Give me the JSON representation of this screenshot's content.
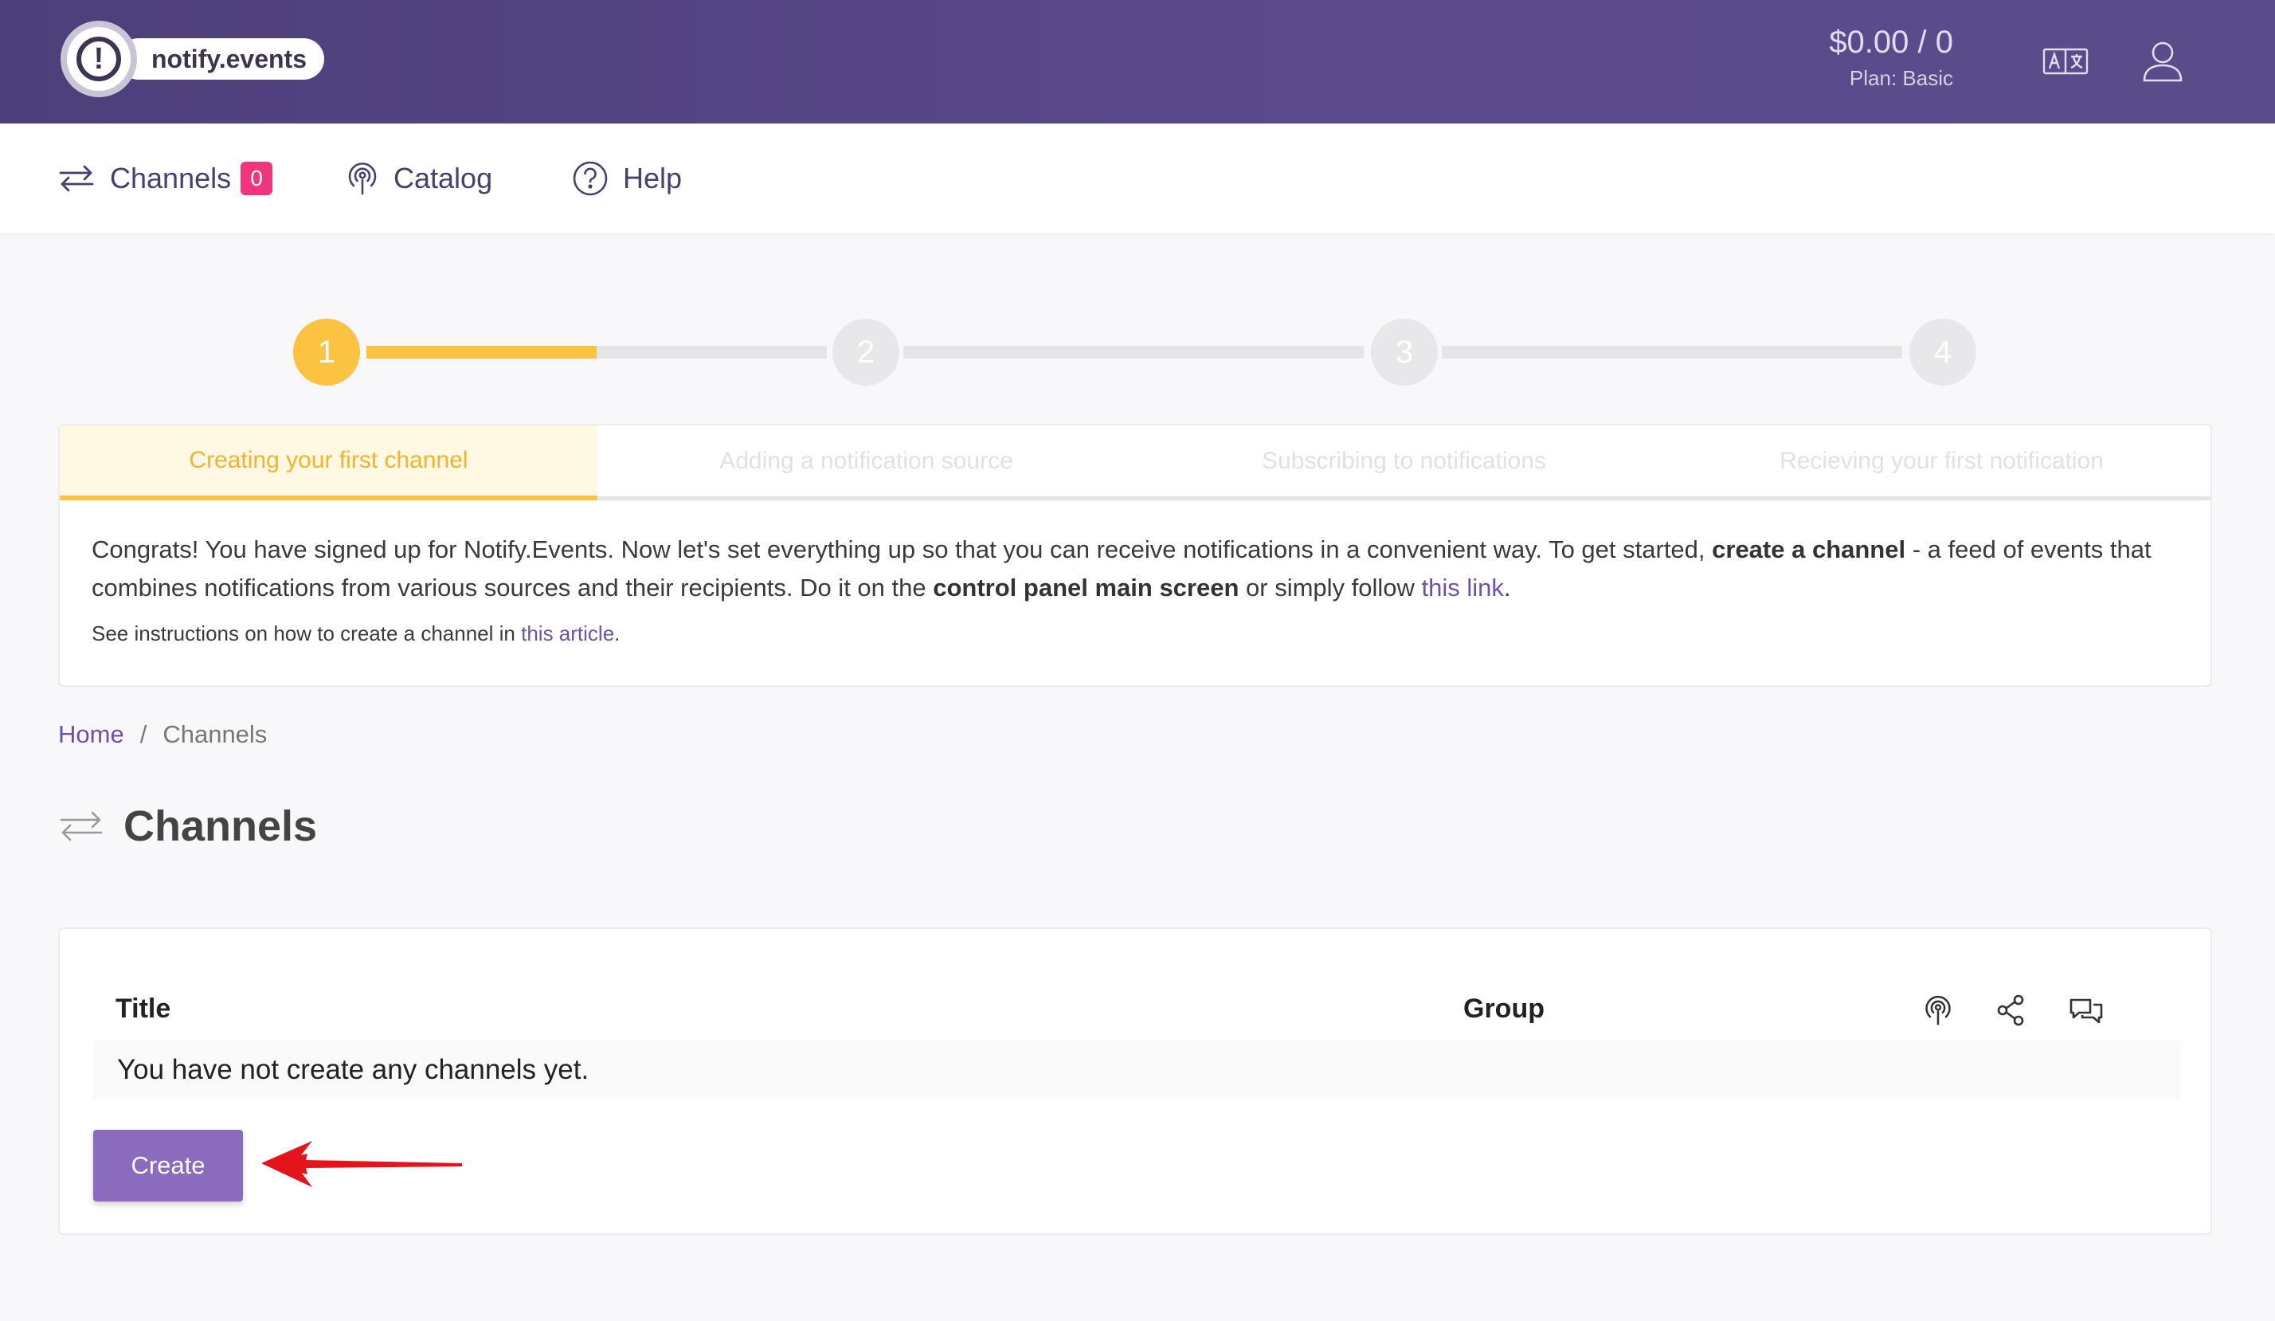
{
  "header": {
    "logo_text": "notify.events",
    "logo_mark": "!",
    "balance": "$0.00 / 0",
    "plan": "Plan: Basic",
    "icons": {
      "language": "translate-icon",
      "user": "user-icon"
    }
  },
  "nav": {
    "items": [
      {
        "label": "Channels",
        "badge": "0",
        "icon": "arrows-exchange-icon"
      },
      {
        "label": "Catalog",
        "icon": "podcast-icon"
      },
      {
        "label": "Help",
        "icon": "question-circle-icon"
      }
    ]
  },
  "stepper": {
    "steps": [
      "1",
      "2",
      "3",
      "4"
    ],
    "active_step": 1,
    "first_segment_fill": 0.5,
    "colors": {
      "active": "#fbc341",
      "inactive": "#e8e8ea"
    }
  },
  "onboarding": {
    "tabs": [
      "Creating your first channel",
      "Adding a notification source",
      "Subscribing to notifications",
      "Recieving your first notification"
    ],
    "text_1": "Congrats! You have signed up for Notify.Events. Now let's set everything up so that you can receive notifications in a convenient way. To get started, ",
    "bold_1": "create a channel",
    "text_2": " - a feed of events that combines notifications from various sources and their recipients. Do it on the ",
    "bold_2": "control panel main screen",
    "text_3": " or simply follow ",
    "link_1": "this link",
    "text_4": ".",
    "note_text": "See instructions on how to create a channel in ",
    "note_link": "this article",
    "note_end": "."
  },
  "breadcrumb": {
    "home": "Home",
    "separator": "/",
    "current": "Channels"
  },
  "page_title": "Channels",
  "table": {
    "columns": {
      "title": "Title",
      "group": "Group"
    },
    "column_icons": [
      "podcast-icon",
      "share-icon",
      "chat-bubbles-icon"
    ],
    "empty_message": "You have not create any channels yet."
  },
  "create_button": "Create",
  "colors": {
    "brand": "#5b4a8c",
    "accent": "#8a6bbd",
    "badge": "#f0357d",
    "annotation_arrow": "#e5141b"
  }
}
